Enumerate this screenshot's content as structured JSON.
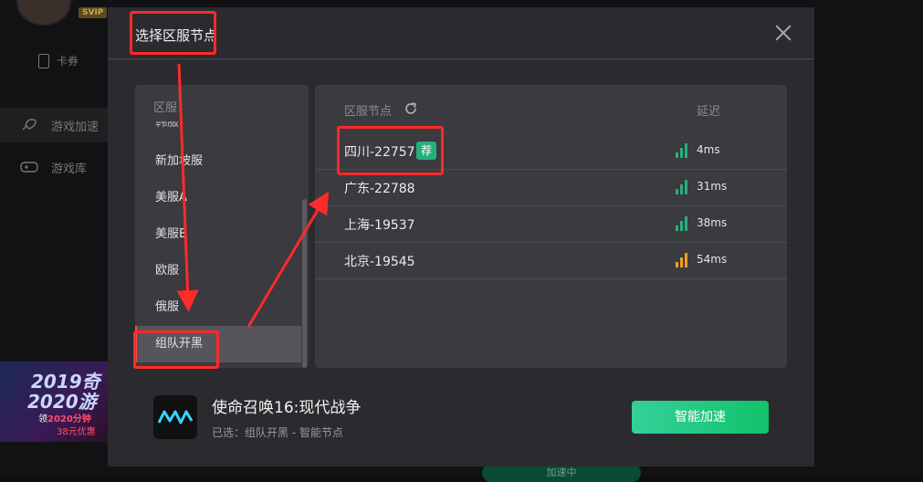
{
  "background_app": {
    "svip_badge": "SVIP",
    "coupon_label": "卡券",
    "nav": [
      {
        "label": "游戏加速",
        "icon": "rocket-icon",
        "active": true
      },
      {
        "label": "游戏库",
        "icon": "gamepad-icon",
        "active": false
      }
    ],
    "banner": {
      "line1": "2019奇",
      "line2": "2020游",
      "line3_prefix": "领",
      "line3_highlight": "2020分钟",
      "line4": "38元优惠"
    },
    "bottom_button": "加速中"
  },
  "modal": {
    "title": "选择区服节点",
    "close_icon": "close-icon",
    "regions": {
      "header": "区服",
      "partial_item": "韩服",
      "items": [
        {
          "label": "新加坡服",
          "selected": false
        },
        {
          "label": "美服A",
          "selected": false
        },
        {
          "label": "美服B",
          "selected": false
        },
        {
          "label": "欧服",
          "selected": false
        },
        {
          "label": "俄服",
          "selected": false
        },
        {
          "label": "组队开黑",
          "selected": true
        }
      ]
    },
    "nodes": {
      "header_label": "区服节点",
      "refresh_icon": "refresh-icon",
      "latency_header": "延迟",
      "rows": [
        {
          "name": "四川-22757",
          "badge": "荐",
          "latency": "4ms",
          "signal_color": "#25b07a"
        },
        {
          "name": "广东-22788",
          "badge": "",
          "latency": "31ms",
          "signal_color": "#25b07a"
        },
        {
          "name": "上海-19537",
          "badge": "",
          "latency": "38ms",
          "signal_color": "#25b07a"
        },
        {
          "name": "北京-19545",
          "badge": "",
          "latency": "54ms",
          "signal_color": "#f0a020"
        }
      ]
    },
    "game": {
      "logo_icon": "game-logo-icon",
      "title": "使命召唤16:现代战争",
      "subtitle": "已选：组队开黑 - 智能节点",
      "accelerate_button": "智能加速"
    }
  },
  "colors": {
    "accent_green": "#25b07a",
    "annotation_red": "#ff2a2a",
    "warning_orange": "#f0a020"
  }
}
